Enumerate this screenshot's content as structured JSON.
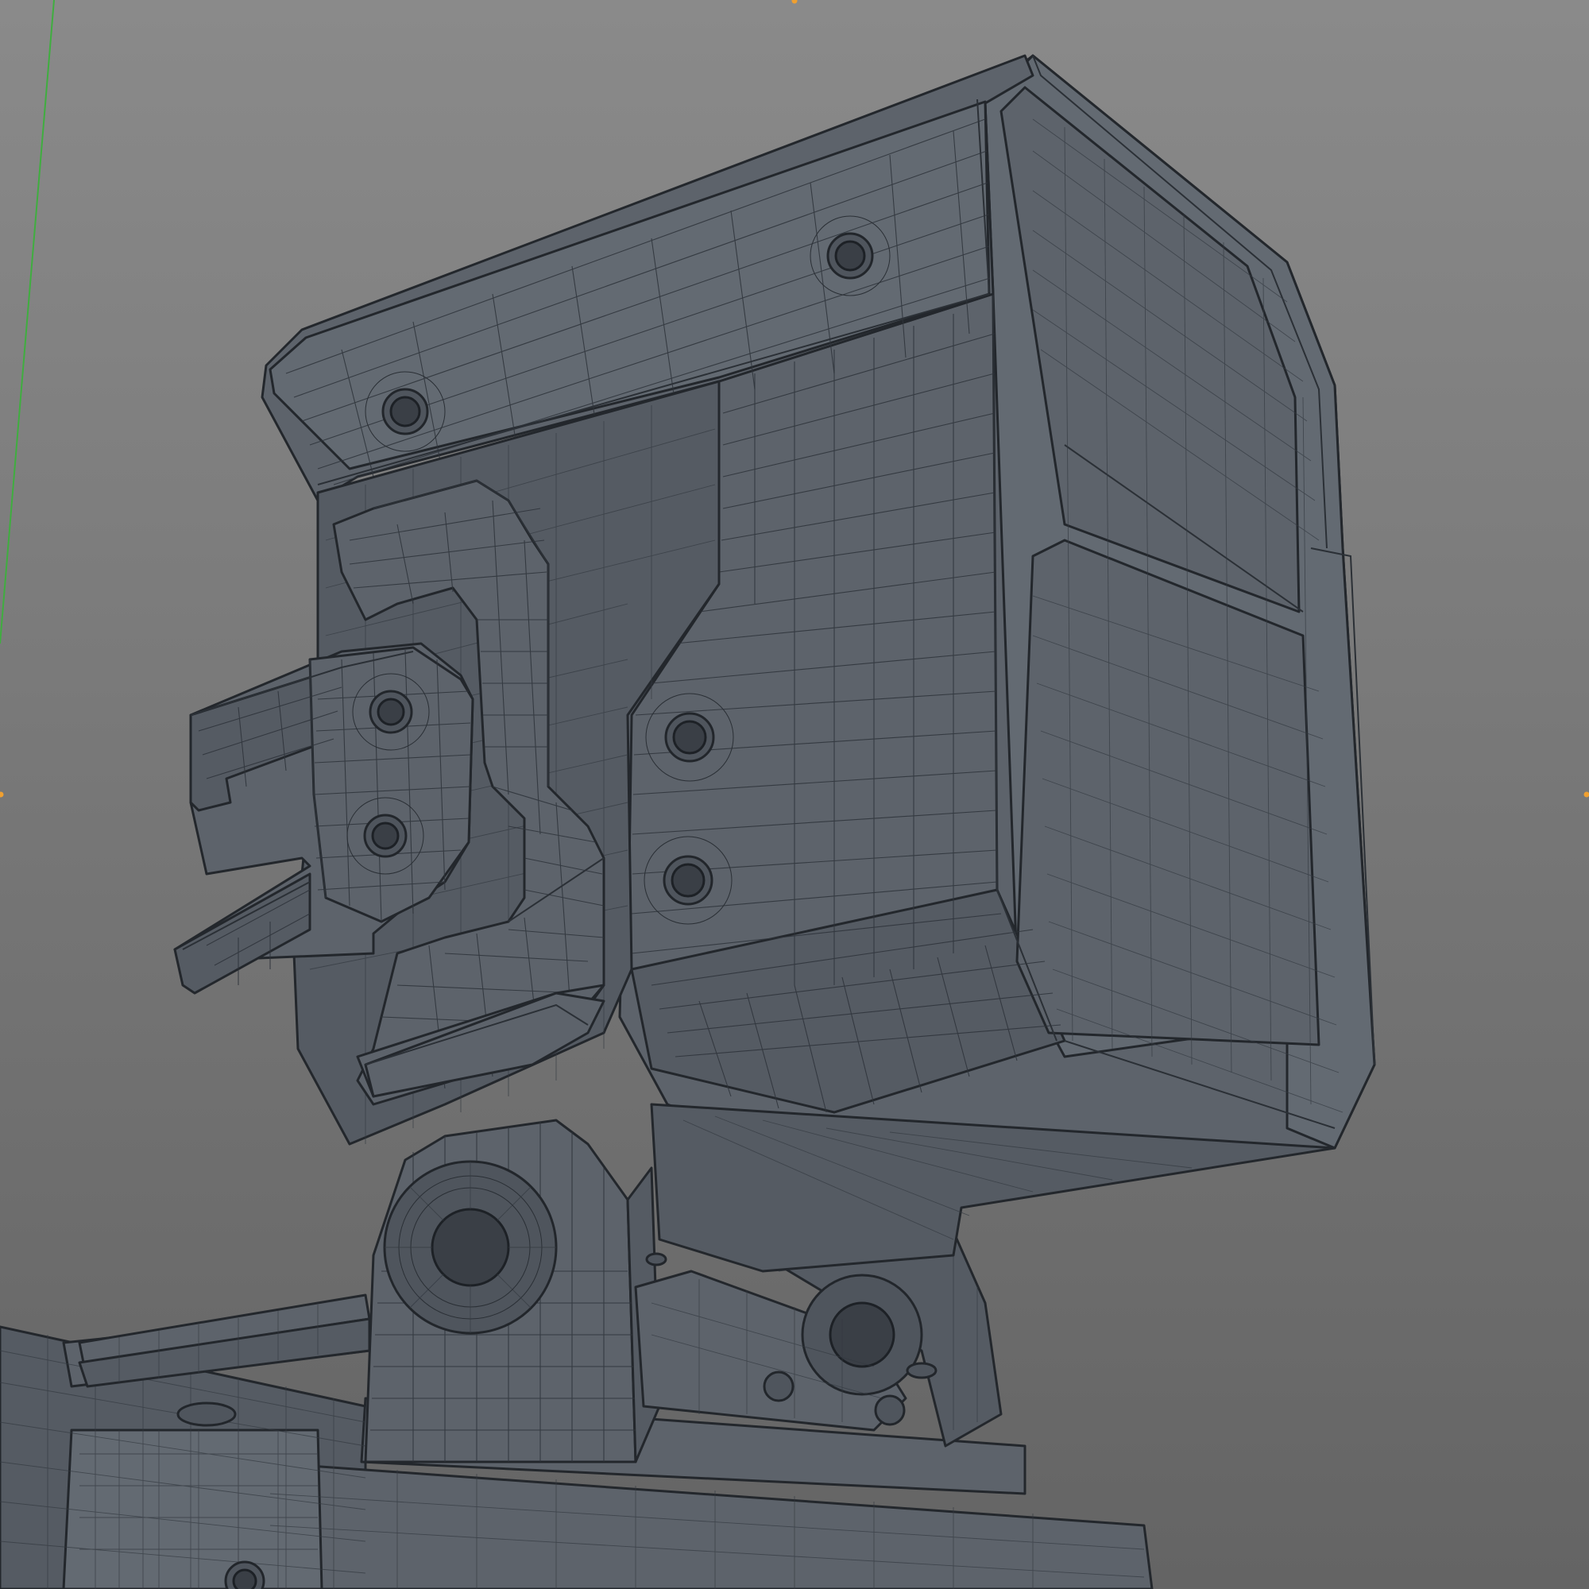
{
  "viewport": {
    "view": "perspective",
    "shading": "wireframe-on-shaded",
    "background": [
      "#8a8a8a",
      "#646464"
    ],
    "mesh_color": "#5d636b",
    "wire_color": "#23272c",
    "axis_color": "#3fae3f",
    "marker_color": "#f0a030"
  },
  "model": {
    "parts": [
      "camera-housing",
      "top-plate",
      "side-bracket",
      "front-bracket",
      "hinge-mount",
      "base-plate"
    ],
    "screw_holes": 7
  }
}
